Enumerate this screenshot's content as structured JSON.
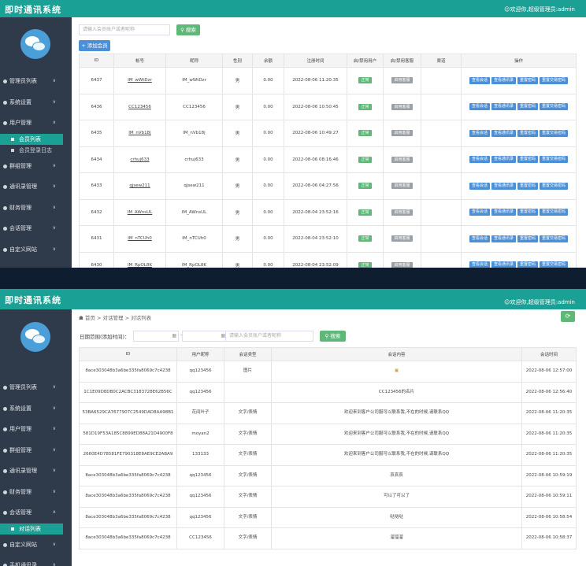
{
  "app": {
    "brand": "即时通讯系统",
    "welcome": "☺欢迎你,超级管理员:admin"
  },
  "screen1": {
    "menu": [
      {
        "label": "管理员列表",
        "chevron": "∨"
      },
      {
        "label": "系统设置",
        "chevron": "∨"
      },
      {
        "label": "用户管理",
        "chevron": "∧"
      },
      {
        "label": "群组管理",
        "chevron": "∨"
      },
      {
        "label": "通讯录管理",
        "chevron": "∨"
      },
      {
        "label": "财务管理",
        "chevron": "∨"
      },
      {
        "label": "会话管理",
        "chevron": "∨"
      },
      {
        "label": "自定义网站",
        "chevron": "∨"
      }
    ],
    "submenu": [
      "会员列表",
      "会员登录日志"
    ],
    "search_placeholder": "请输入会员账户或者昵称",
    "search_button": "搜索",
    "add_button": "+ 添加会员",
    "columns": [
      "ID",
      "帐号",
      "昵称",
      "性别",
      "余额",
      "注册时间",
      "启/禁用用户",
      "启/禁用客服",
      "渠道",
      "操作"
    ],
    "rows": [
      {
        "id": "6437",
        "account": "IM_wWtDzr",
        "nick": "IM_wWtDzr",
        "gender": "男",
        "balance": "0.00",
        "time": "2022-08-06 11:20:35",
        "user_status": "正常",
        "cs_status": "启用客服",
        "channel": ""
      },
      {
        "id": "6436",
        "account": "CC123456",
        "nick": "CC123456",
        "gender": "男",
        "balance": "0.00",
        "time": "2022-08-06 10:50:45",
        "user_status": "正常",
        "cs_status": "启用客服",
        "channel": ""
      },
      {
        "id": "6435",
        "account": "IM_nVb18j",
        "nick": "IM_nVb18j",
        "gender": "男",
        "balance": "0.00",
        "time": "2022-08-06 10:49:27",
        "user_status": "正常",
        "cs_status": "启用客服",
        "channel": ""
      },
      {
        "id": "6434",
        "account": "crhuj633",
        "nick": "crhuj633",
        "gender": "男",
        "balance": "0.00",
        "time": "2022-08-06 08:16:46",
        "user_status": "正常",
        "cs_status": "启用客服",
        "channel": ""
      },
      {
        "id": "6433",
        "account": "qjsew211",
        "nick": "qjsew211",
        "gender": "男",
        "balance": "0.00",
        "time": "2022-08-06 04:27:56",
        "user_status": "正常",
        "cs_status": "启用客服",
        "channel": ""
      },
      {
        "id": "6432",
        "account": "IM_AWnsUL",
        "nick": "IM_AWnsUL",
        "gender": "男",
        "balance": "0.00",
        "time": "2022-08-04 23:52:16",
        "user_status": "正常",
        "cs_status": "启用客服",
        "channel": ""
      },
      {
        "id": "6431",
        "account": "IM_nTCUh0",
        "nick": "IM_nTCUh0",
        "gender": "男",
        "balance": "0.00",
        "time": "2022-08-04 23:52:10",
        "user_status": "正常",
        "cs_status": "启用客服",
        "channel": ""
      },
      {
        "id": "6430",
        "account": "IM_RpOL8K",
        "nick": "IM_RpOL8K",
        "gender": "男",
        "balance": "0.00",
        "time": "2022-08-04 23:52:09",
        "user_status": "正常",
        "cs_status": "启用客服",
        "channel": ""
      }
    ],
    "op_buttons": [
      "查看会话",
      "查看通讯录",
      "重置密码",
      "重置交易密码"
    ]
  },
  "screen2": {
    "menu": [
      {
        "label": "管理员列表",
        "chevron": "∨"
      },
      {
        "label": "系统设置",
        "chevron": "∨"
      },
      {
        "label": "用户管理",
        "chevron": "∨"
      },
      {
        "label": "群组管理",
        "chevron": "∨"
      },
      {
        "label": "通讯录管理",
        "chevron": "∨"
      },
      {
        "label": "财务管理",
        "chevron": "∨"
      },
      {
        "label": "会话管理",
        "chevron": "∧"
      }
    ],
    "submenu_active": "对话列表",
    "menu_after": [
      {
        "label": "自定义网站",
        "chevron": "∨"
      },
      {
        "label": "手机通讯录",
        "chevron": "∨"
      }
    ],
    "breadcrumb": [
      "首页",
      "对话管理",
      "对话列表"
    ],
    "date_label": "日期范围(添加时间)：",
    "date_start_icon": "calendar-icon",
    "date_sep": "-",
    "search_placeholder": "请输入会员账户或者昵称",
    "search_button": "搜索",
    "refresh_icon": "⟳",
    "columns": [
      "ID",
      "用户昵称",
      "会话类型",
      "会话内容",
      "会话时间"
    ],
    "rows": [
      {
        "id": "8ace303048b3a6be335fa8069c7c4238",
        "nick": "qq123456",
        "type": "图片",
        "content": "▣",
        "time": "2022-08-06 12:57:00"
      },
      {
        "id": "1C1E09D8DB0C2ACBC3183728E62B56C",
        "nick": "qq123456",
        "type": "",
        "content": "CC123456的名片",
        "time": "2022-08-06 12:56:40"
      },
      {
        "id": "53BA6529CA7677907C2549DAD8AA98B1",
        "nick": "花间叶子",
        "type": "文字/表情",
        "content": "欢迎来到客户公司服可以联系我,不在的时候,请联系QQ",
        "time": "2022-08-06 11:20:35"
      },
      {
        "id": "581D19F53A185C8899ED88A21D4900F8",
        "nick": "moyan2",
        "type": "文字/表情",
        "content": "欢迎来到客户公司服可以联系我,不在的时候,请联系QQ",
        "time": "2022-08-06 11:20:35"
      },
      {
        "id": "2660E4D78581FE790318E8AE9CE2ABA9",
        "nick": "133133",
        "type": "文字/表情",
        "content": "欢迎来到客户公司服可以联系我,不在的时候,请联系QQ",
        "time": "2022-08-06 11:20:35"
      },
      {
        "id": "8ace303048b3a6be335fa8069c7c4238",
        "nick": "qq123456",
        "type": "文字/表情",
        "content": "哀哀哀",
        "time": "2022-08-06 10:59:19"
      },
      {
        "id": "8ace303048b3a6be335fa8069c7c4238",
        "nick": "qq123456",
        "type": "文字/表情",
        "content": "可以了可以了",
        "time": "2022-08-06 10:59:11"
      },
      {
        "id": "8ace303048b3a6be335fa8069c7c4238",
        "nick": "qq123456",
        "type": "文字/表情",
        "content": "哒哒哒",
        "time": "2022-08-06 10:58:54"
      },
      {
        "id": "8ace303048b3a6be335fa8069c7c4238",
        "nick": "CC123456",
        "type": "文字/表情",
        "content": "溜溜溜",
        "time": "2022-08-06 10:58:37"
      }
    ]
  }
}
